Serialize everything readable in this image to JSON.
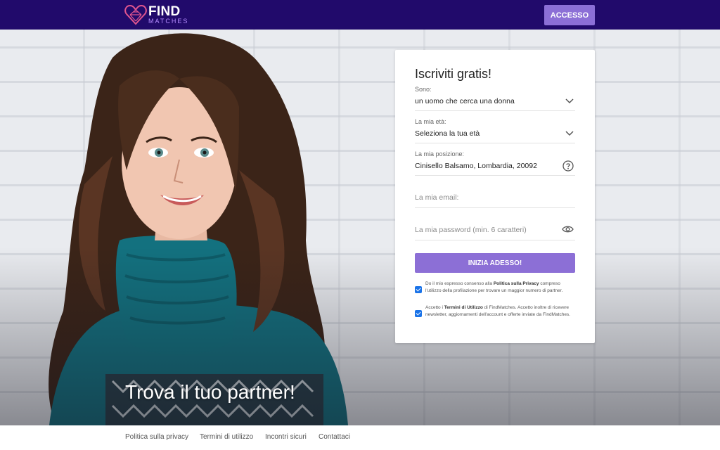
{
  "header": {
    "logo_find": "FIND",
    "logo_matches": "MATCHES",
    "login_button": "ACCESSO"
  },
  "hero": {
    "title": "Trova il tuo partner!"
  },
  "signup": {
    "title": "Iscriviti gratis!",
    "fields": {
      "sono_label": "Sono:",
      "sono_value": "un uomo che cerca una donna",
      "eta_label": "La mia età:",
      "eta_value": "Seleziona la tua età",
      "posizione_label": "La mia posizione:",
      "posizione_value": "Cinisello Balsamo, Lombardia, 20092",
      "email_placeholder": "La mia email:",
      "password_placeholder": "La mia password (min. 6 caratteri)"
    },
    "submit_button": "INIZIA ADESSO!",
    "consent_privacy": {
      "before": "Do il mio espresso consenso alla ",
      "link": "Politica sulla Privacy",
      "after": " compreso l'utilizzo della profilazione per trovare un maggior numero di partner."
    },
    "consent_terms": {
      "before": "Accetto i ",
      "link": "Termini di Utilizzo",
      "after": " di FindMatches. Accetto inoltre di ricevere newsletter, aggiornamenti dell'account e offerte inviate da FindMatches."
    }
  },
  "footer": {
    "links": [
      "Politica sulla privacy",
      "Termini di utilizzo",
      "Incontri sicuri",
      "Contattaci"
    ]
  },
  "colors": {
    "topbar": "#210a6b",
    "accent": "#8c6fd6",
    "checkbox": "#1a73e8"
  },
  "icons": {
    "logo": "heart-logo-icon",
    "dropdown": "chevron-down-icon",
    "help": "question-circle-icon",
    "password": "eye-icon"
  }
}
